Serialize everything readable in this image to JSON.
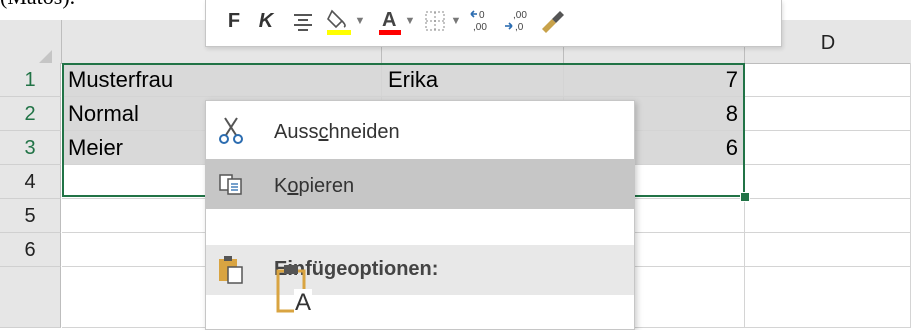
{
  "caption": "(Matos).",
  "columns": [
    {
      "key": "A",
      "label": ""
    },
    {
      "key": "B",
      "label": ""
    },
    {
      "key": "C",
      "label": ""
    },
    {
      "key": "D",
      "label": "D"
    }
  ],
  "rows": [
    {
      "num": "1",
      "a": "Musterfrau",
      "b": "Erika",
      "c": "7"
    },
    {
      "num": "2",
      "a": "Normal",
      "b": "",
      "c": "8"
    },
    {
      "num": "3",
      "a": "Meier",
      "b": "",
      "c": "6"
    },
    {
      "num": "4",
      "a": "",
      "b": "",
      "c": ""
    },
    {
      "num": "5",
      "a": "",
      "b": "",
      "c": ""
    },
    {
      "num": "6",
      "a": "",
      "b": "",
      "c": ""
    }
  ],
  "toolbar": {
    "bold": "F",
    "italic": "K",
    "icons": [
      "bold-icon",
      "italic-icon",
      "align-center-icon",
      "fill-color-icon",
      "font-color-icon",
      "borders-icon",
      "increase-decimal-icon",
      "decrease-decimal-icon",
      "format-painter-icon"
    ],
    "colors": {
      "fill": "#ffff00",
      "font": "#ff0000",
      "grid_green": "#217346"
    }
  },
  "context_menu": {
    "cut": {
      "pre": "Auss",
      "u": "c",
      "post": "hneiden"
    },
    "copy": {
      "pre": "K",
      "u": "o",
      "post": "pieren"
    },
    "paste_options": "Einfügeoptionen:",
    "paste_letter": "A"
  }
}
